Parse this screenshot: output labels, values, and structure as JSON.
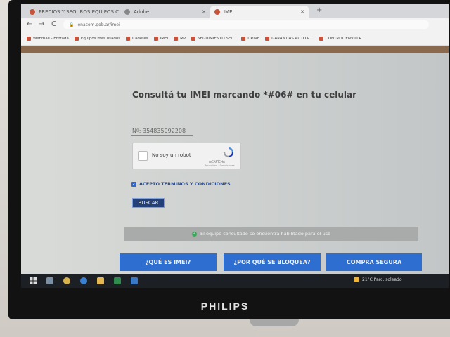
{
  "tabs": [
    {
      "label": "PRECIOS Y SEGUROS EQUIPOS C",
      "active": false,
      "color": "#c9533a"
    },
    {
      "label": "Adobe",
      "active": false,
      "color": "#888888"
    },
    {
      "label": "IMEI",
      "active": true,
      "color": "#c9533a"
    }
  ],
  "toolbar": {
    "back": "←",
    "forward": "→",
    "reload": "C",
    "url": "enacom.gob.ar/imei"
  },
  "bookmarks": [
    "Webmail - Entrada",
    "Equipos mas usados",
    "Cadetes",
    "IMEI",
    "MP",
    "SEGUIMIENTO SEI...",
    "DRIVE",
    "GARANTIAS AUTO R...",
    "CONTROL ENVIO R..."
  ],
  "page": {
    "title": "Consultá tu IMEI marcando *#06# en tu celular",
    "imei_value": "Nº: 354835092208",
    "captcha": {
      "label": "No soy un robot",
      "brand": "reCAPTCHA",
      "links": "Privacidad - Condiciones"
    },
    "terms_label": "ACEPTO TERMINOS Y CONDICIONES",
    "search_label": "BUSCAR",
    "status_message": "El equipo consultado se encuentra habilitado para el uso",
    "buttons": [
      "¿QUÉ ES IMEI?",
      "¿POR QUÉ SE BLOQUEA?",
      "COMPRA SEGURA"
    ]
  },
  "taskbar": {
    "weather": "21°C  Parc. soleado"
  },
  "monitor": {
    "brand": "PHILIPS"
  },
  "colors": {
    "accent_blue": "#2d6ed0",
    "search_button": "#23407a",
    "status_bar": "#a8aba9",
    "success_green": "#3aa85a"
  }
}
